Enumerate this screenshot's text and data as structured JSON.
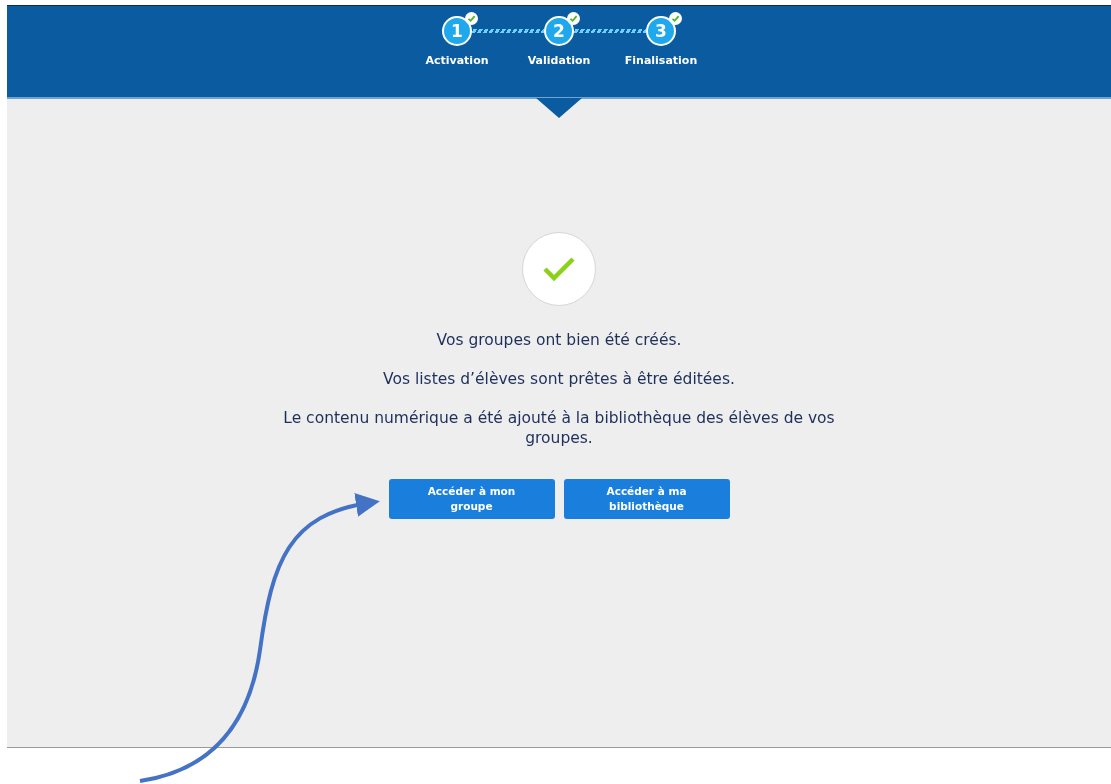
{
  "steps": [
    {
      "number": "1",
      "label": "Activation",
      "done": true,
      "selected": false
    },
    {
      "number": "2",
      "label": "Validation",
      "done": true,
      "selected": true
    },
    {
      "number": "3",
      "label": "Finalisation",
      "done": true,
      "selected": false
    }
  ],
  "messages": [
    "Vos groupes ont bien été créés.",
    "Vos listes d’élèves sont prêtes à être éditées.",
    "Le contenu numérique a été ajouté à la bibliothèque des élèves de vos groupes."
  ],
  "buttons": [
    "Accéder à mon groupe",
    "Accéder à ma bibliothèque"
  ]
}
